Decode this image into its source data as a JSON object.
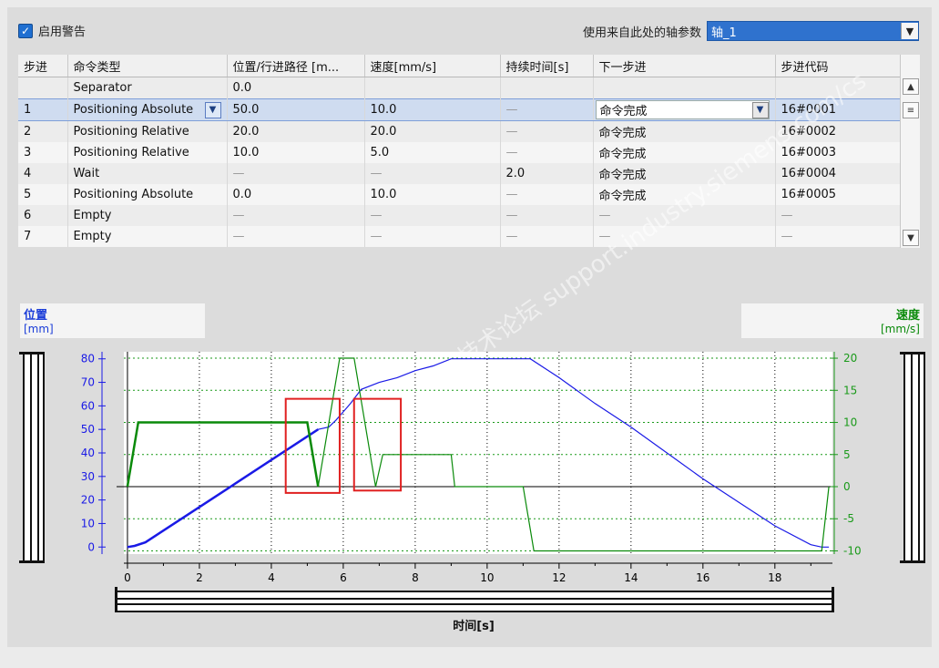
{
  "top": {
    "enable_warning_label": "启用警告",
    "axis_param_label": "使用来自此处的轴参数",
    "axis_param_value": "轴_1"
  },
  "table": {
    "headers": [
      "步进",
      "命令类型",
      "位置/行进路径 [m...",
      "速度[mm/s]",
      "持续时间[s]",
      "下一步进",
      "步进代码"
    ],
    "rows": [
      [
        "",
        "Separator",
        "0.0",
        "",
        "",
        "",
        ""
      ],
      [
        "1",
        "Positioning Absolute",
        "50.0",
        "10.0",
        "—",
        "命令完成",
        "16#0001"
      ],
      [
        "2",
        "Positioning Relative",
        "20.0",
        "20.0",
        "—",
        "命令完成",
        "16#0002"
      ],
      [
        "3",
        "Positioning Relative",
        "10.0",
        "5.0",
        "—",
        "命令完成",
        "16#0003"
      ],
      [
        "4",
        "Wait",
        "—",
        "—",
        "2.0",
        "命令完成",
        "16#0004"
      ],
      [
        "5",
        "Positioning Absolute",
        "0.0",
        "10.0",
        "—",
        "命令完成",
        "16#0005"
      ],
      [
        "6",
        "Empty",
        "—",
        "—",
        "—",
        "—",
        "—"
      ],
      [
        "7",
        "Empty",
        "—",
        "—",
        "—",
        "—",
        "—"
      ]
    ]
  },
  "chart_labels": {
    "left_title": "位置",
    "left_unit": "[mm]",
    "right_title": "速度",
    "right_unit": "[mm/s]",
    "x_title": "时间[s]"
  },
  "watermark": "西门子工业 技术论坛 support.industry.siemens.com/cs",
  "chart_data": {
    "type": "line",
    "x_ticks": [
      0,
      2,
      4,
      6,
      8,
      10,
      12,
      14,
      16,
      18
    ],
    "y_left_ticks": [
      0,
      10,
      20,
      30,
      40,
      50,
      60,
      70,
      80
    ],
    "y_right_ticks": [
      -10,
      -5,
      0,
      5,
      10,
      15,
      20
    ],
    "xlim": [
      -0.1,
      19.6
    ],
    "ylim_left": [
      -3,
      83
    ],
    "ylim_right": [
      -10.5,
      21
    ],
    "grid": true,
    "series": [
      {
        "axis": "left",
        "color": "#1a1ae6",
        "x": [
          0,
          0.2,
          0.5,
          1,
          2,
          3,
          4,
          4.5,
          5,
          5.3,
          5.6,
          5.8,
          6.2,
          6.5,
          7,
          7.5,
          8,
          8.5,
          9,
          10,
          11,
          11.2,
          12,
          13,
          14,
          15,
          16,
          17,
          18,
          19,
          19.3,
          19.5
        ],
        "y": [
          0,
          0.5,
          2,
          7,
          17,
          27,
          37,
          42,
          47,
          50,
          51,
          54,
          61,
          67,
          70,
          72,
          75,
          77,
          80,
          80,
          80,
          80,
          72,
          61,
          51,
          40,
          29,
          19,
          9,
          1,
          0,
          0
        ]
      },
      {
        "axis": "right",
        "color": "#0a8a0a",
        "x": [
          0,
          0.3,
          5,
          5.3,
          5.9,
          6.3,
          6.9,
          7.1,
          9,
          9.1,
          11,
          11.3,
          19,
          19.3,
          19.5
        ],
        "y": [
          0,
          10,
          10,
          0,
          20,
          20,
          0,
          5,
          5,
          0,
          0,
          -10,
          -10,
          -10,
          0
        ]
      }
    ],
    "annotations": [
      {
        "x0": 4.4,
        "x1": 5.9,
        "y0": 23,
        "y1": 63
      },
      {
        "x0": 6.3,
        "x1": 7.6,
        "y0": 24,
        "y1": 63
      }
    ]
  }
}
